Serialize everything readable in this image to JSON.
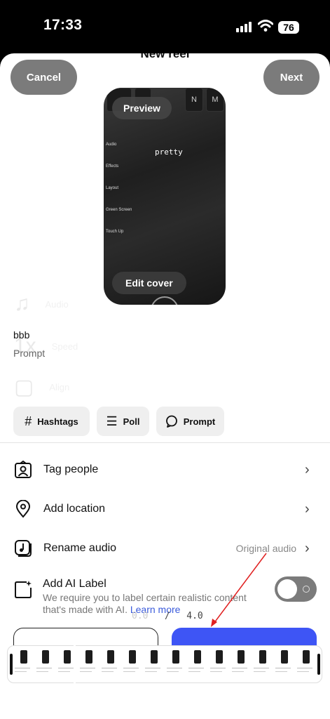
{
  "status_bar": {
    "time": "17:33",
    "battery": "76"
  },
  "header": {
    "title": "New reel",
    "cancel_label": "Cancel",
    "next_label": "Next"
  },
  "preview": {
    "preview_label": "Preview",
    "edit_cover_label": "Edit cover",
    "overlay_text": "pretty",
    "keys": [
      "",
      "",
      "N",
      "M"
    ],
    "side_options": [
      "Audio",
      "Effects",
      "Layout",
      "Green Screen",
      "Touch Up"
    ]
  },
  "background_tools": [
    "Audio",
    "Speed",
    "Align"
  ],
  "caption": {
    "text": "bbb",
    "subtext": "Prompt"
  },
  "chips": [
    {
      "label": "Hashtags",
      "icon": "hash-icon"
    },
    {
      "label": "Poll",
      "icon": "list-icon"
    },
    {
      "label": "Prompt",
      "icon": "speech-bubble-icon"
    }
  ],
  "rows": [
    {
      "label": "Tag people",
      "icon": "tag-person-icon",
      "value": ""
    },
    {
      "label": "Add location",
      "icon": "location-pin-icon",
      "value": ""
    },
    {
      "label": "Rename audio",
      "icon": "music-note-icon",
      "value": "Original audio"
    }
  ],
  "ai_label": {
    "title": "Add AI Label",
    "description": "We require you to label certain realistic content that's made with AI.",
    "link": "Learn more",
    "enabled": false
  },
  "timeline": {
    "current": "0.0",
    "separator": "/",
    "total": "4.0"
  },
  "filmstrip": {
    "frame_count": 14
  },
  "colors": {
    "accent_blue": "#3e55f5",
    "pill_gray": "#7b7b7b",
    "annotation_red": "#e02020"
  }
}
